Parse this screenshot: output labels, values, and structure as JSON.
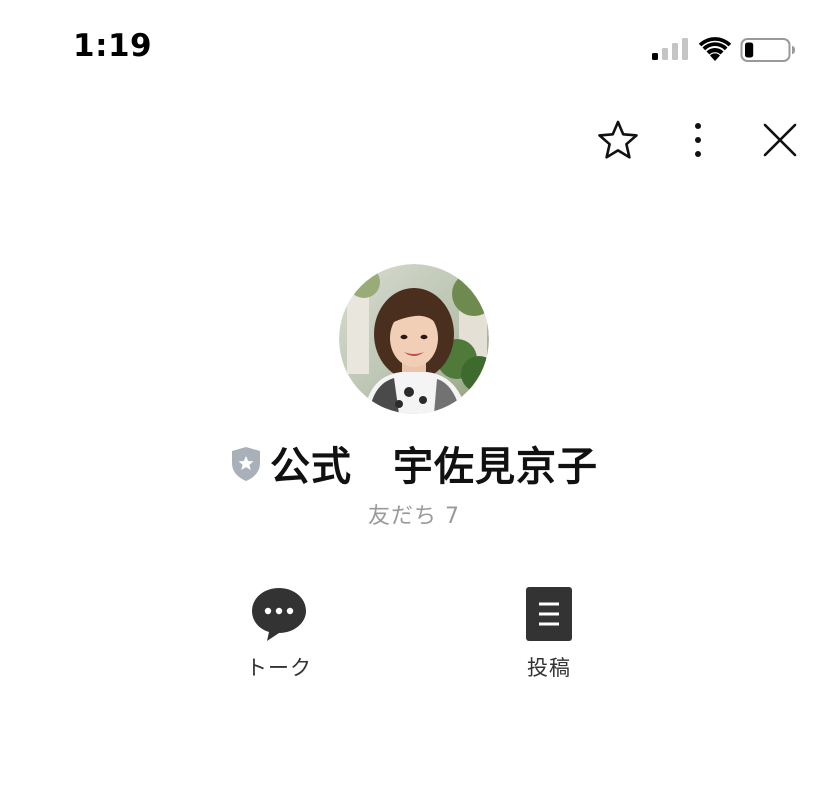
{
  "status_bar": {
    "time": "1:19",
    "signal_icon": "cellular-signal-icon",
    "wifi_icon": "wifi-icon",
    "battery_icon": "battery-icon",
    "battery_level": 0.2
  },
  "top_actions": {
    "favorite_icon": "star-outline-icon",
    "more_icon": "vertical-ellipsis-icon",
    "close_icon": "close-icon"
  },
  "profile": {
    "badge_icon": "official-shield-icon",
    "badge_color": "#a9b0b8",
    "name": "公式　宇佐見京子",
    "friends_label": "友だち 7"
  },
  "actions": [
    {
      "label": "トーク",
      "icon": "chat-bubble-icon"
    },
    {
      "label": "投稿",
      "icon": "posts-document-icon"
    }
  ],
  "colors": {
    "icon_dark": "#333333",
    "muted_text": "#9a9a9a",
    "background": "#ffffff"
  }
}
